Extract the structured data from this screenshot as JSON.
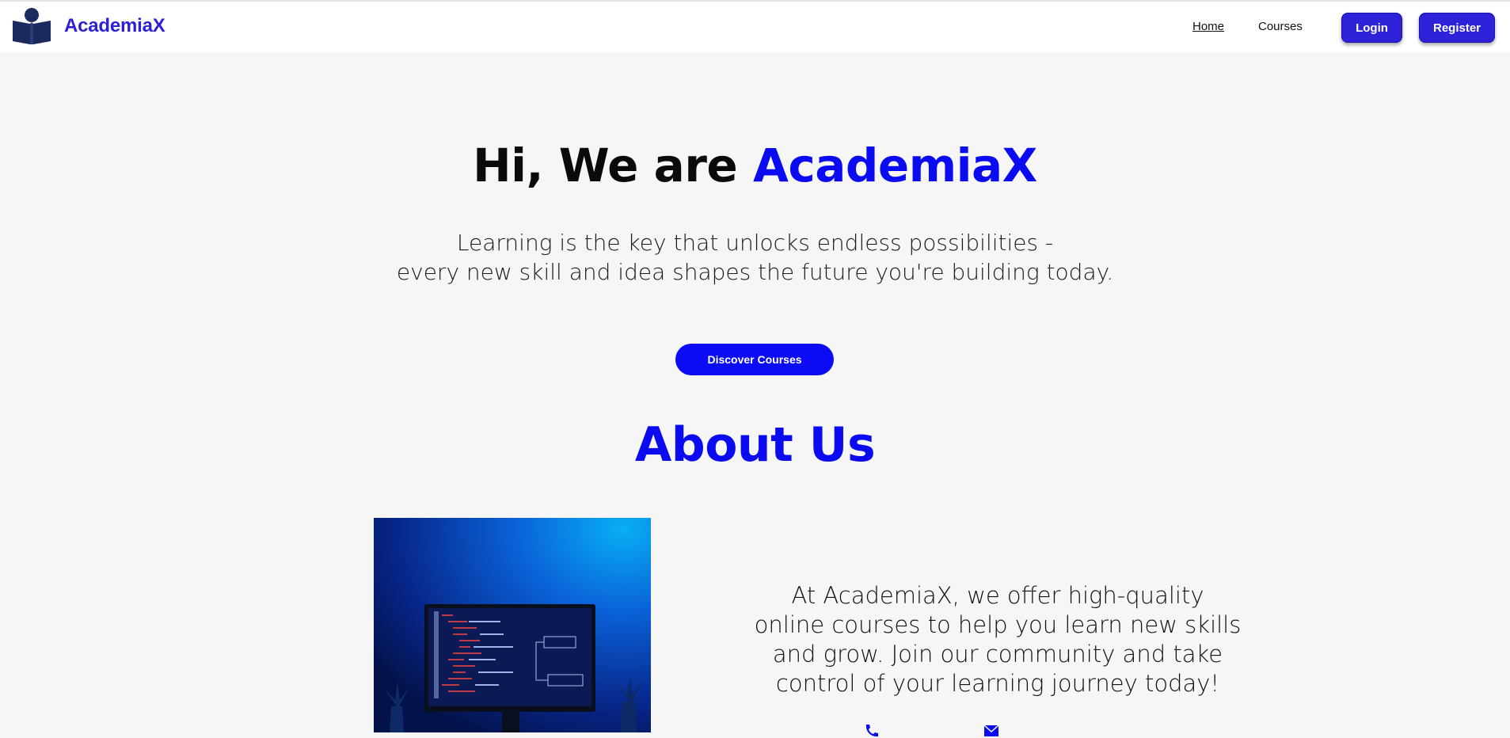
{
  "brand": {
    "name": "AcademiaX",
    "logo_icon": "book-reader-icon",
    "color": "#2d1fd6"
  },
  "nav": {
    "links": [
      {
        "label": "Home",
        "active": true
      },
      {
        "label": "Courses",
        "active": false
      }
    ],
    "login_label": "Login",
    "register_label": "Register"
  },
  "hero": {
    "title_prefix": "Hi, We are ",
    "title_accent": "AcademiaX",
    "subtitle_line1": "Learning is the key that unlocks endless possibilities -",
    "subtitle_line2": "every new skill and idea shapes the future you're building today.",
    "cta_label": "Discover Courses"
  },
  "about": {
    "title": "About Us",
    "image_icon": "code-monitor-image",
    "text_lines": [
      "At AcademiaX, we offer high-quality",
      "online courses to help you learn new skills",
      "and grow. Join our community and take",
      "control of your learning journey today!"
    ],
    "contact": {
      "phone_icon": "phone-icon",
      "email_icon": "email-icon"
    }
  },
  "colors": {
    "accent": "#0b0bf2",
    "button": "#2d22d8",
    "background": "#f6f6f6"
  }
}
